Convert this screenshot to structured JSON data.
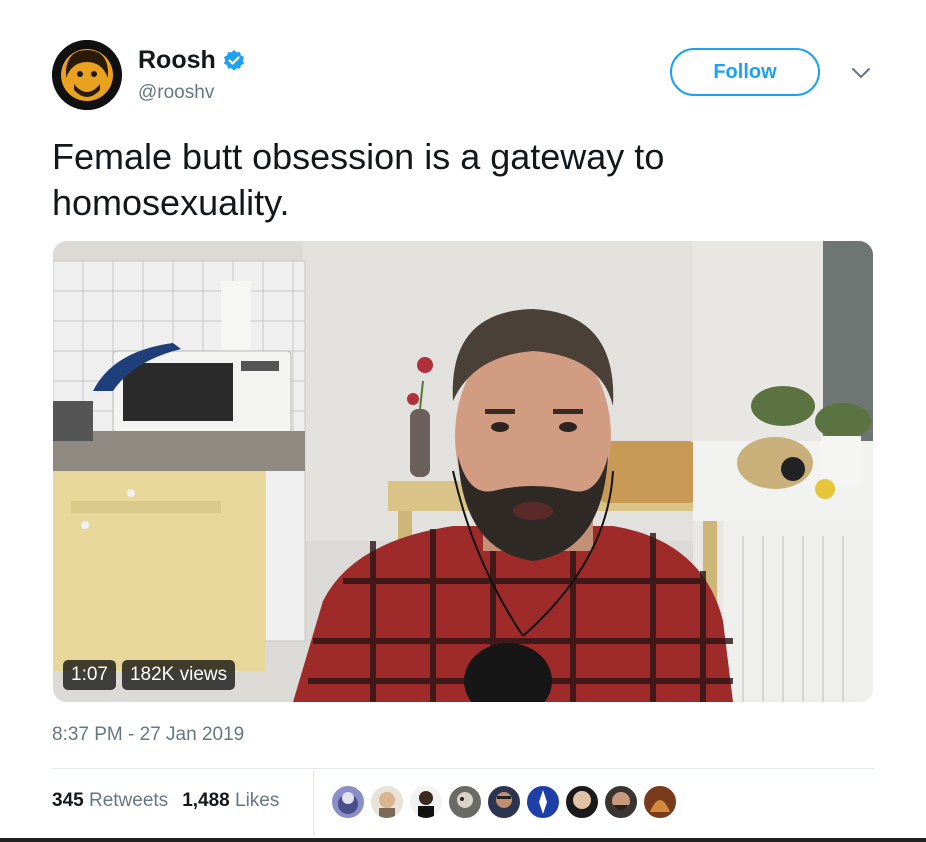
{
  "author": {
    "display_name": "Roosh",
    "handle": "@rooshv",
    "verified": true,
    "avatar_icon": "profile-avatar"
  },
  "actions": {
    "follow_label": "Follow",
    "menu_icon": "chevron-down-icon"
  },
  "tweet": {
    "text": "Female butt obsession is a gateway to homosexuality.",
    "timestamp": "8:37 PM - 27 Jan 2019"
  },
  "video": {
    "duration": "1:07",
    "views": "182K views"
  },
  "engagement": {
    "retweets_count": "345",
    "retweets_label": "Retweets",
    "likes_count": "1,488",
    "likes_label": "Likes"
  },
  "colors": {
    "brand_blue": "#1da1f2",
    "text_primary": "#14171a",
    "text_secondary": "#657786"
  }
}
